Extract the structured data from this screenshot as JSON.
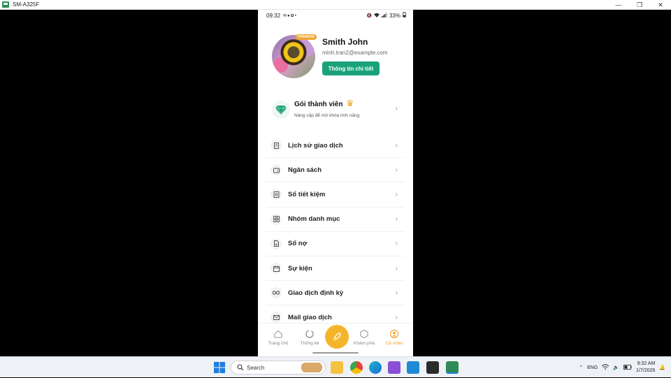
{
  "window": {
    "title": "SM-A325F",
    "controls": [
      "minimize",
      "restore",
      "close"
    ]
  },
  "status_bar": {
    "time": "09:32",
    "battery": "33%"
  },
  "profile": {
    "badge": "PREMIUM",
    "name": "Smith John",
    "email": "minh.tran2@example.com",
    "detail_button": "Thông tin chi tiết"
  },
  "membership": {
    "title": "Gói thành viên",
    "subtitle": "Nâng cấp để mở khóa tính năng"
  },
  "menu": {
    "items": [
      {
        "label": "Lịch sử giao dịch",
        "icon": "receipt-icon"
      },
      {
        "label": "Ngân sách",
        "icon": "wallet-icon"
      },
      {
        "label": "Sổ tiết kiệm",
        "icon": "savings-book-icon"
      },
      {
        "label": "Nhóm danh mục",
        "icon": "grid-icon"
      },
      {
        "label": "Sổ nợ",
        "icon": "document-icon"
      },
      {
        "label": "Sự kiện",
        "icon": "calendar-icon"
      },
      {
        "label": "Giao dịch định kỳ",
        "icon": "infinity-icon"
      },
      {
        "label": "Mail giao dịch",
        "icon": "mail-icon"
      }
    ]
  },
  "bottom_nav": {
    "items": [
      {
        "label": "Trang chủ"
      },
      {
        "label": "Thống kê"
      },
      {
        "label": "Khám phá"
      },
      {
        "label": "Cá nhân"
      }
    ],
    "active": "Cá nhân",
    "accent": "#f2a52a"
  },
  "taskbar": {
    "search_label": "Search",
    "language": "ENG",
    "clock_time": "9:32 AM",
    "clock_date": "1/7/2026"
  },
  "colors": {
    "primary_button": "#1aa37a",
    "accent": "#f2a52a"
  }
}
